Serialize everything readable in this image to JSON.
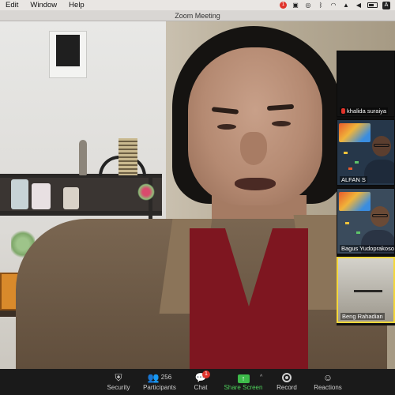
{
  "menubar": {
    "items": [
      "Edit",
      "Window",
      "Help"
    ],
    "status_icons": [
      "recording-badge-icon",
      "zoom-icon",
      "cc-icon",
      "bluetooth-icon",
      "wifi-icon",
      "airplay-icon",
      "volume-icon",
      "battery-icon",
      "user-icon"
    ],
    "record_badge": "1"
  },
  "window": {
    "title": "Zoom Meeting"
  },
  "gallery": {
    "tiles": [
      {
        "name": "khalida suraiya",
        "muted": true
      },
      {
        "name": "ALFAN S",
        "muted": false
      },
      {
        "name": "Bagus Yudoprakoso",
        "muted": false
      },
      {
        "name": "Beng Rahadian",
        "muted": false
      }
    ],
    "active_speaker_border_color": "#f5d73a"
  },
  "toolbar": {
    "security_label": "Security",
    "participants_label": "Participants",
    "participants_count": "256",
    "chat_label": "Chat",
    "chat_badge": "1",
    "share_label": "Share Screen",
    "record_label": "Record",
    "reactions_label": "Reactions",
    "accent_color": "#3dbb4a",
    "badge_color": "#e0342b"
  }
}
